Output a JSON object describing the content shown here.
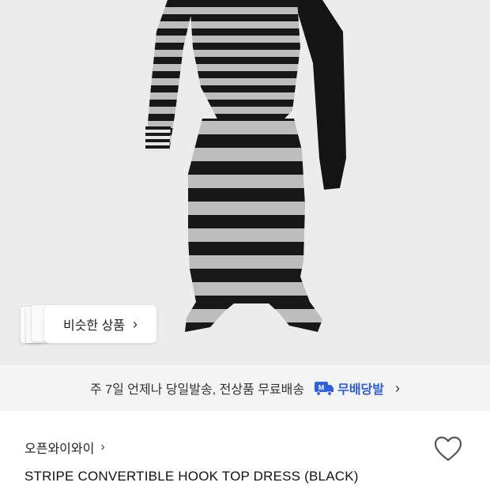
{
  "similar": {
    "label": "비슷한 상품"
  },
  "shipping": {
    "text": "주 7일 언제나 당일발송, 전상품 무료배송",
    "badge_letter": "M",
    "badge_label": "무배당발",
    "accent": "#2f5fe0"
  },
  "product": {
    "brand": "오픈와이와이",
    "title": "STRIPE CONVERTIBLE HOOK TOP DRESS (BLACK)"
  },
  "icons": {
    "heart": "heart-icon",
    "chevron": "chevron-right-icon"
  }
}
